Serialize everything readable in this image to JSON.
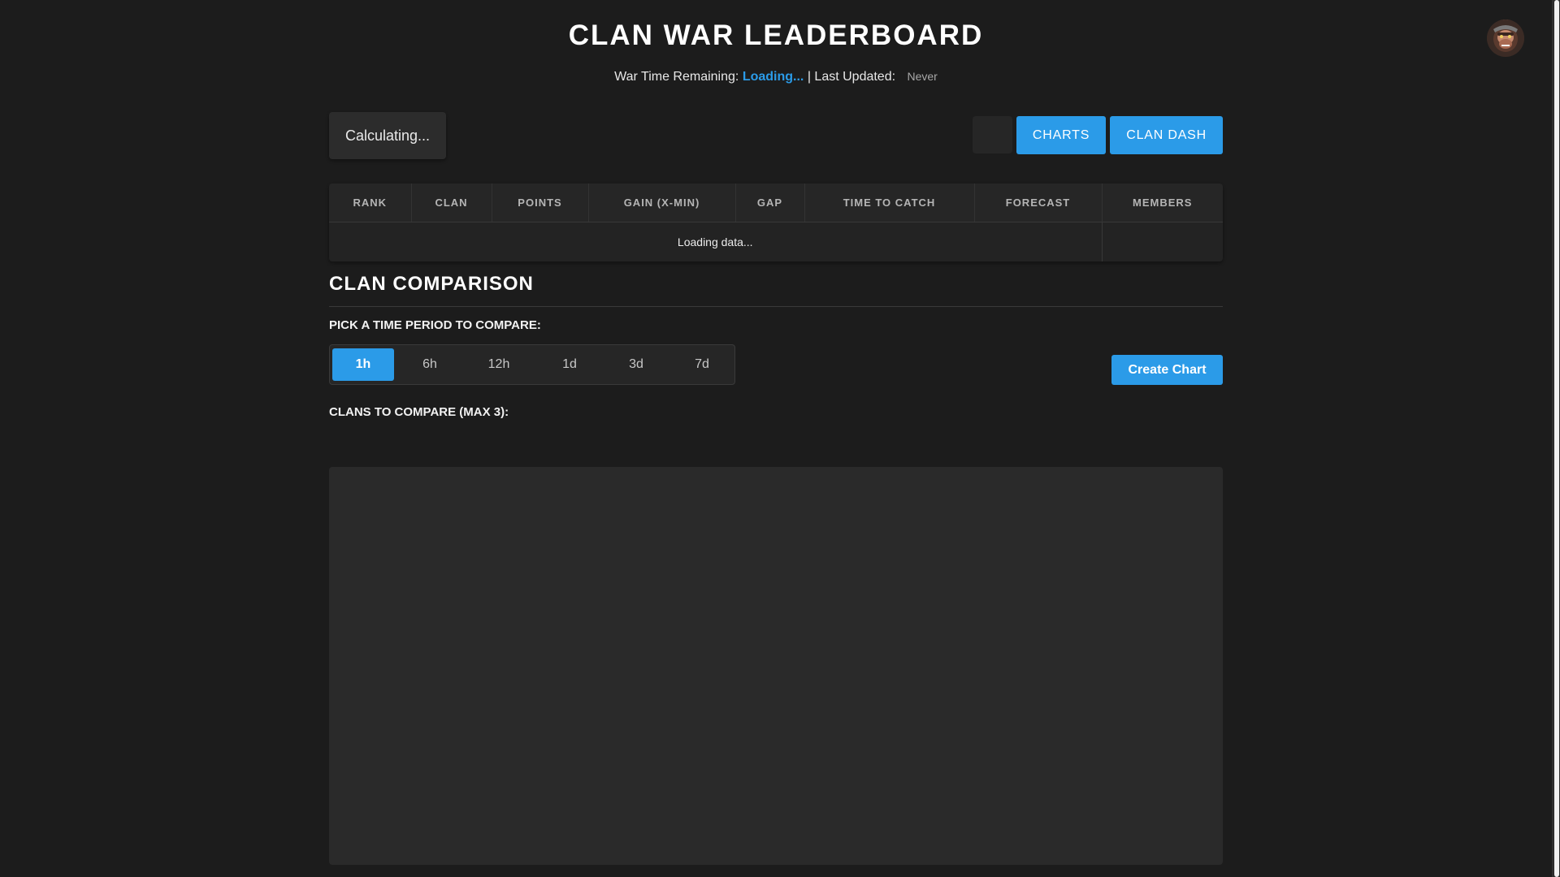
{
  "header": {
    "title": "CLAN WAR LEADERBOARD",
    "war_time_label": "War Time Remaining:",
    "war_time_value": "Loading...",
    "separator": "|",
    "last_updated_label": "Last Updated:",
    "last_updated_value": "Never"
  },
  "status": {
    "text": "Calculating..."
  },
  "toolbar": {
    "charts_label": "CHARTS",
    "clan_dash_label": "CLAN DASH"
  },
  "table": {
    "columns": [
      "RANK",
      "CLAN",
      "POINTS",
      "GAIN (X-MIN)",
      "GAP",
      "TIME TO CATCH",
      "FORECAST",
      "MEMBERS"
    ],
    "loading_text": "Loading data..."
  },
  "comparison": {
    "title": "CLAN COMPARISON",
    "period_label": "PICK A TIME PERIOD TO COMPARE:",
    "periods": [
      "1h",
      "6h",
      "12h",
      "1d",
      "3d",
      "7d"
    ],
    "active_period": "1h",
    "create_chart_label": "Create Chart",
    "clans_label": "CLANS TO COMPARE (MAX 3):"
  },
  "colors": {
    "accent": "#2b9be8",
    "background": "#1c1c1c",
    "panel": "#2a2a2a"
  },
  "icons": {
    "avatar": "gorilla-avatar-icon"
  }
}
